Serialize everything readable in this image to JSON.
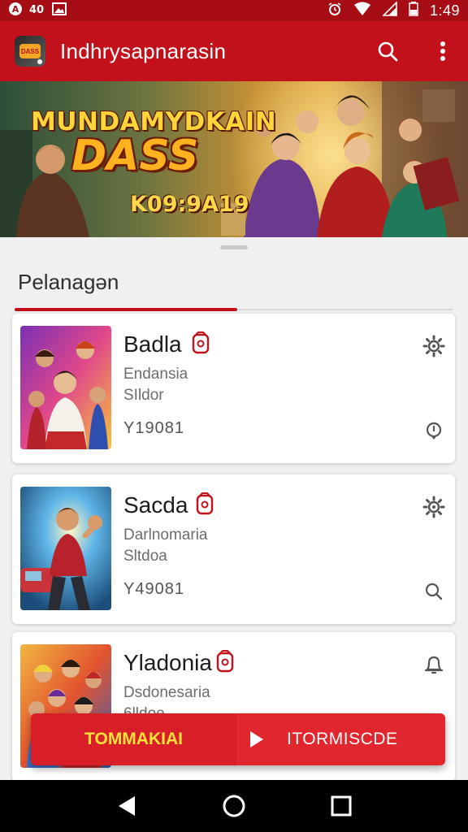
{
  "status_bar": {
    "time": "1:49"
  },
  "app_bar": {
    "title": "Indhrysapnarasin",
    "logo_text": "DASS"
  },
  "banner": {
    "line1": "MUNDAMYDKAIN",
    "line2": "DASS",
    "line3": "K09:9A19"
  },
  "sheet": {
    "section_title": "Pelanagən"
  },
  "items": [
    {
      "name": "Badla",
      "sub1": "Endansia",
      "sub2": "SIldor",
      "num": "Y19081"
    },
    {
      "name": "Sacda",
      "sub1": "Darlnomaria",
      "sub2": "Sltdoa",
      "num": "Y49081"
    },
    {
      "name": "Yladonia",
      "sub1": "Dsdonesaria",
      "sub2": "6lldoe",
      "num": ""
    }
  ],
  "action_bar": {
    "left_label": "TOMMAKIAI",
    "right_label": "ITORMISCDE"
  },
  "colors": {
    "primary": "#c3111b",
    "status": "#a70d14",
    "accent_yellow": "#ffe23a"
  }
}
